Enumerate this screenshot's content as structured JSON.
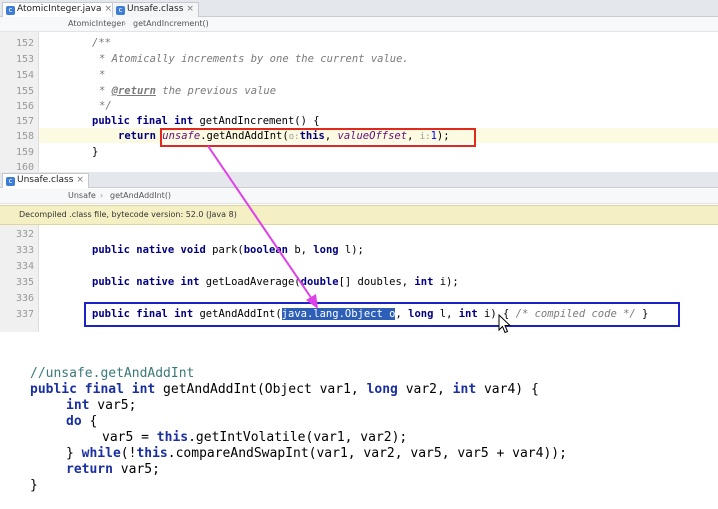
{
  "top_editor": {
    "tabs": [
      {
        "label": "AtomicInteger.java",
        "icon": "class-icon",
        "active": true
      },
      {
        "label": "Unsafe.class",
        "icon": "class-icon",
        "active": false
      }
    ],
    "breadcrumb": [
      "AtomicInteger",
      "getAndIncrement()"
    ],
    "lines": [
      {
        "num": "152"
      },
      {
        "num": "153"
      },
      {
        "num": "154"
      },
      {
        "num": "155"
      },
      {
        "num": "156"
      },
      {
        "num": "157"
      },
      {
        "num": "158"
      },
      {
        "num": "159"
      },
      {
        "num": "160"
      }
    ],
    "code": {
      "l152": "/**",
      "l153": "* Atomically increments by one the current value.",
      "l154": "*",
      "l155_tag": "@return",
      "l155_text": " the previous value",
      "l156": "*/",
      "l157_kw": "public final int",
      "l157_rest": " getAndIncrement() {",
      "l158_kw": "return",
      "l158_field": "unsafe",
      "l158_call": ".getAndAddInt(",
      "l158_hint1": "o:",
      "l158_this": "this",
      "l158_sep": ", ",
      "l158_field2": "valueOffset",
      "l158_sep2": ", ",
      "l158_hint2": "i:",
      "l158_num": "1",
      "l158_end": ");",
      "l159": "}"
    }
  },
  "bottom_editor": {
    "tab": {
      "label": "Unsafe.class",
      "icon": "class-icon"
    },
    "breadcrumb": [
      "Unsafe",
      "getAndAddInt()"
    ],
    "banner": "Decompiled .class file, bytecode version: 52.0 (Java 8)",
    "lines": [
      {
        "num": "332"
      },
      {
        "num": "333"
      },
      {
        "num": "334"
      },
      {
        "num": "335"
      },
      {
        "num": "336"
      },
      {
        "num": "337"
      }
    ],
    "code": {
      "l333_kw": "public native void",
      "l333_a": " park(",
      "l333_kw2": "boolean",
      "l333_b": " b, ",
      "l333_kw3": "long",
      "l333_c": " l);",
      "l335_kw": "public native int",
      "l335_a": " getLoadAverage(",
      "l335_kw2": "double",
      "l335_b": "[] doubles, ",
      "l335_kw3": "int",
      "l335_c": " i);",
      "l337_kw": "public final int",
      "l337_a": " getAndAddInt(",
      "l337_sel": "java.lang.Object o",
      "l337_b": ", ",
      "l337_kw2": "long",
      "l337_c": " l, ",
      "l337_kw3": "int",
      "l337_d": " i) { ",
      "l337_cm": "/* compiled code */",
      "l337_e": " }"
    }
  },
  "snippet": {
    "comment": "//unsafe.getAndAddInt",
    "s1_kw": "public final int",
    "s1_a": " getAndAddInt(Object var1, ",
    "s1_kw2": "long",
    "s1_b": " var2, ",
    "s1_kw3": "int",
    "s1_c": " var4) {",
    "s2_kw": "int",
    "s2_a": " var5;",
    "s3_kw": "do",
    "s3_a": " {",
    "s4_a": "var5 = ",
    "s4_kw": "this",
    "s4_b": ".getIntVolatile(var1, var2);",
    "s5_a": "} ",
    "s5_kw": "while",
    "s5_b": "(!",
    "s5_kw2": "this",
    "s5_c": ".compareAndSwapInt(var1, var2, var5, var5 + var4));",
    "s6_kw": "return",
    "s6_a": " var5;",
    "s7": "}"
  },
  "colors": {
    "red_box": "#e0281c",
    "blue_box": "#1a22c8",
    "arrow": "#e040e8",
    "selection": "#2e5fb8"
  }
}
